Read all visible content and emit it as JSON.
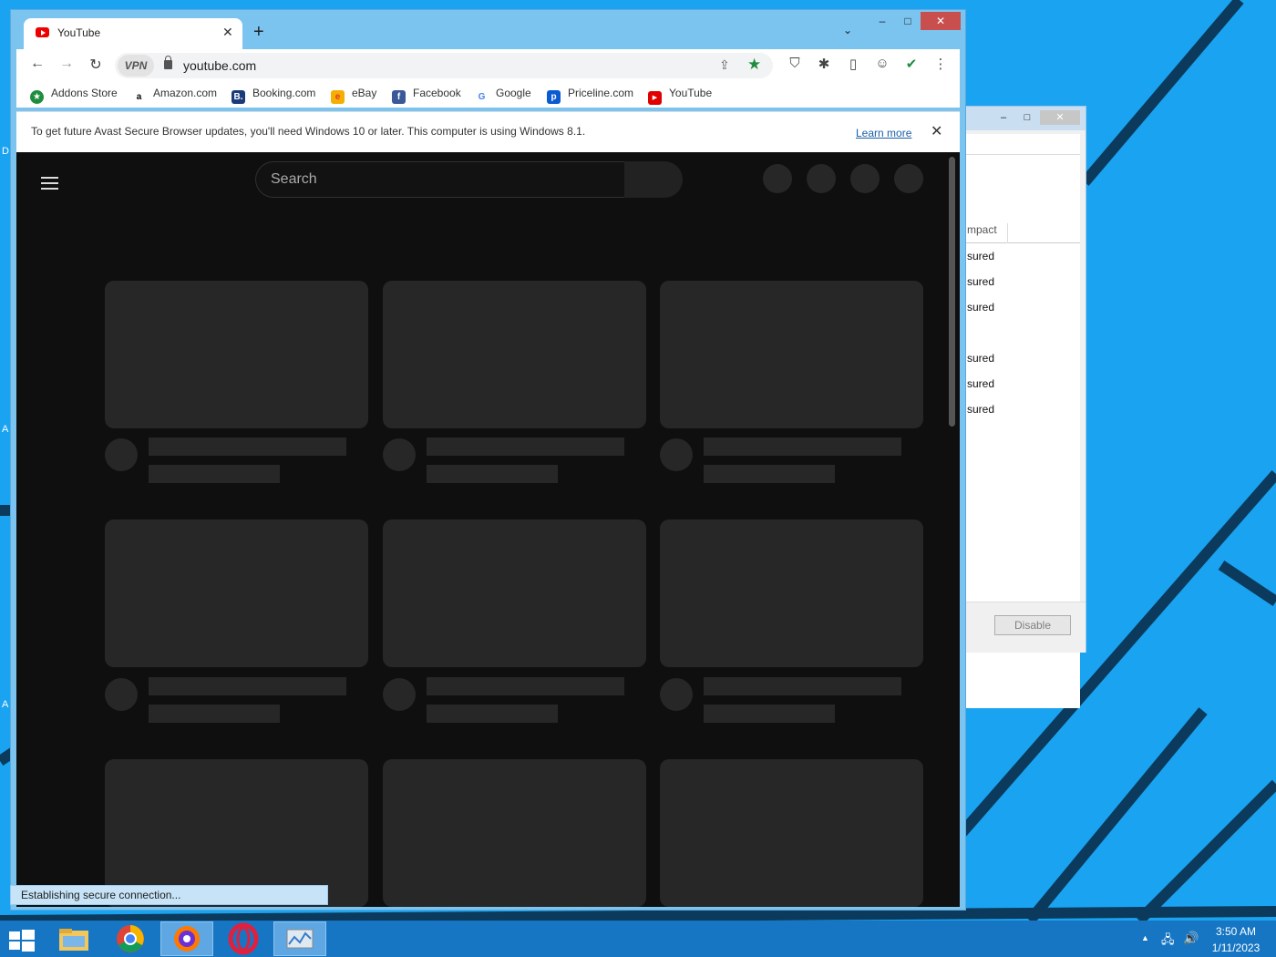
{
  "colors": {
    "desktop_bg": "#1aa3f0",
    "browser_frame": "#7cc4f0",
    "yt_bg": "#0f0f0f",
    "skeleton": "#272727",
    "close_red": "#c94f4f",
    "taskbar": "#1676c3"
  },
  "browser": {
    "tab_title": "YouTube",
    "tab_favicon": "youtube-icon",
    "new_tab_symbol": "+",
    "tab_close_symbol": "✕",
    "tab_list_symbol": "⌄",
    "min_symbol": "–",
    "max_symbol": "□",
    "close_symbol": "✕",
    "toolbar": {
      "back": "←",
      "forward": "→",
      "reload": "↻",
      "vpn_label": "VPN",
      "url": "youtube.com",
      "share": "⇪",
      "star": "★",
      "menu": "⋮",
      "extensions": [
        "shield-icon",
        "puzzle-icon",
        "sidepanel-icon",
        "profile-icon",
        "security-check-icon"
      ]
    },
    "ext_glyphs": [
      "⛉",
      "✱",
      "▯",
      "☺",
      "✔"
    ],
    "bookmarks": [
      {
        "label": "Addons Store",
        "icon": "addons-store-icon",
        "glyph": "★",
        "color": "#1e8e3e"
      },
      {
        "label": "Amazon.com",
        "icon": "amazon-icon",
        "glyph": "a",
        "color": "#222222"
      },
      {
        "label": "Booking.com",
        "icon": "booking-icon",
        "glyph": "B.",
        "color": "#1a3b7a"
      },
      {
        "label": "eBay",
        "icon": "ebay-icon",
        "glyph": "e",
        "color": "#e53238"
      },
      {
        "label": "Facebook",
        "icon": "facebook-icon",
        "glyph": "f",
        "color": "#3b5998"
      },
      {
        "label": "Google",
        "icon": "google-icon",
        "glyph": "G",
        "color": "#ffffff"
      },
      {
        "label": "Priceline.com",
        "icon": "priceline-icon",
        "glyph": "p",
        "color": "#0a5ad4"
      },
      {
        "label": "YouTube",
        "icon": "youtube-icon",
        "glyph": "▶",
        "color": "#e00000"
      }
    ],
    "infobar": {
      "message": "To get future Avast Secure Browser updates, you'll need Windows 10 or later. This computer is using Windows 8.1.",
      "link": "Learn more",
      "close": "✕"
    },
    "status": "Establishing secure connection..."
  },
  "youtube": {
    "search_placeholder": "Search"
  },
  "bg_window": {
    "column_header": "mpact",
    "rows": [
      "sured",
      "sured",
      "sured",
      "sured",
      "sured",
      "sured"
    ],
    "disable_label": "Disable",
    "min_symbol": "–",
    "max_symbol": "□",
    "close_symbol": "✕"
  },
  "desktop_edge_letters": [
    "D",
    "A",
    "A"
  ],
  "taskbar": {
    "apps": [
      "file-explorer-icon",
      "chrome-icon",
      "avast-browser-icon",
      "opera-icon",
      "resource-monitor-icon"
    ],
    "tray_up": "▲",
    "tray_net": "🖧",
    "tray_vol": "🔊",
    "time": "3:50 AM",
    "date": "1/11/2023"
  }
}
